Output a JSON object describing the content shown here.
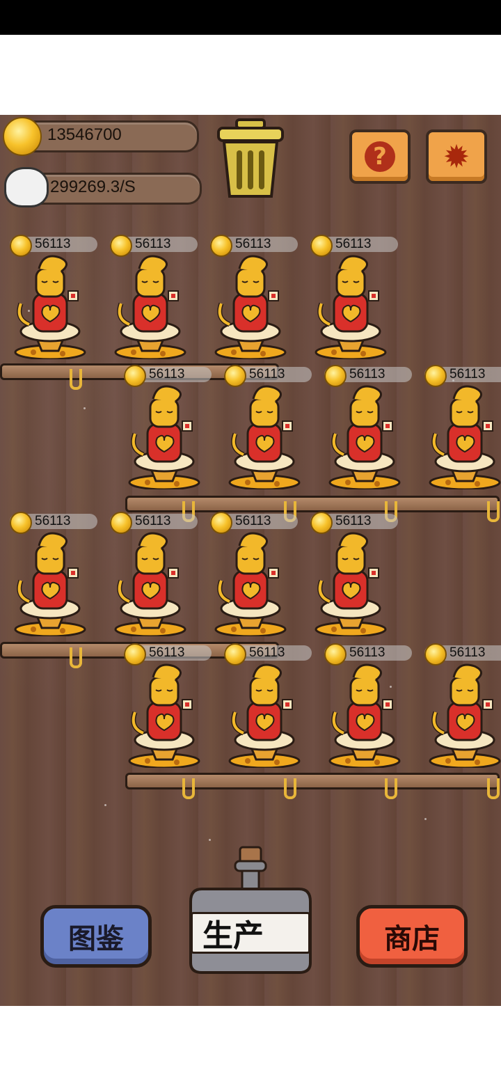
{
  "hud": {
    "coins": "13546700",
    "rate": "299269.3/S"
  },
  "buttons": {
    "help_glyph": "?",
    "settings_glyph": "✹",
    "collection_label": "图鉴",
    "produce_label": "生产",
    "shop_label": "商店"
  },
  "cat_value": "56113",
  "colors": {
    "collection_btn": "#6b82c8",
    "shop_btn": "#f06040",
    "orange_btn": "#f0a34a"
  },
  "icons": [
    "coin-icon",
    "money-bag-icon",
    "trash-can-icon",
    "help-icon",
    "settings-icon",
    "cat-figurine-icon",
    "bottle-icon"
  ]
}
